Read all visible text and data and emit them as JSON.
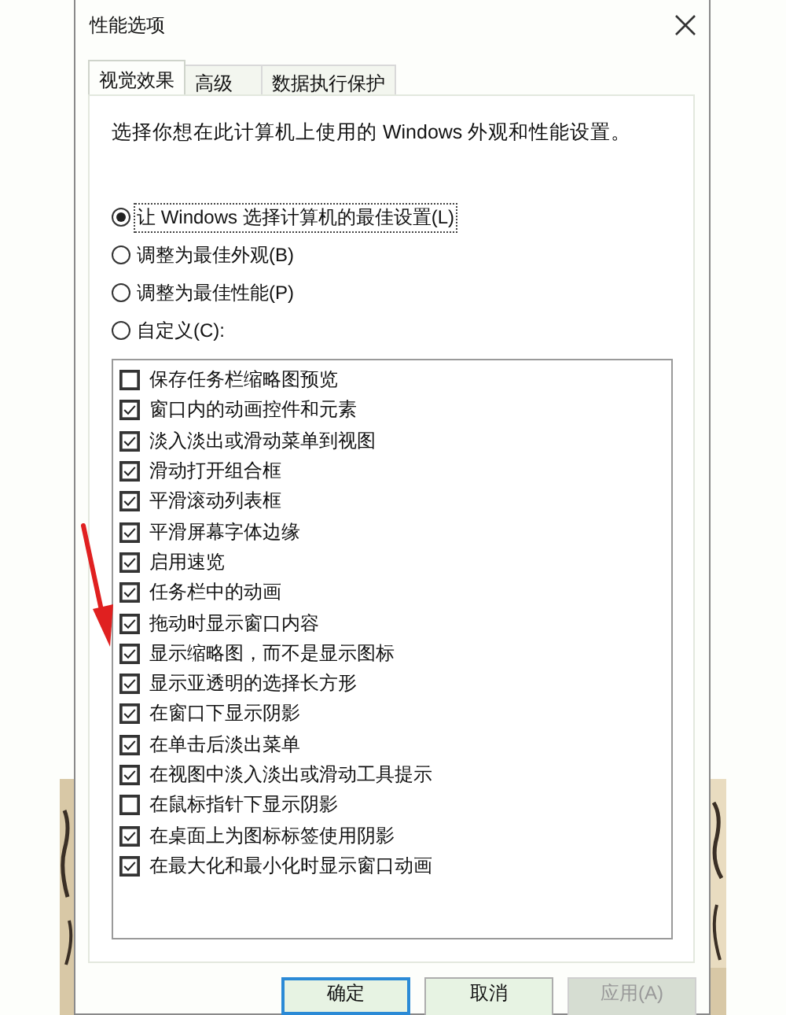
{
  "window": {
    "title": "性能选项"
  },
  "tabs": [
    {
      "label": "视觉效果",
      "selected": true
    },
    {
      "label": "高级",
      "selected": false
    },
    {
      "label": "数据执行保护",
      "selected": false
    }
  ],
  "description": "选择你想在此计算机上使用的 Windows 外观和性能设置。",
  "radios": [
    {
      "label": "让 Windows 选择计算机的最佳设置(L)",
      "selected": true
    },
    {
      "label": "调整为最佳外观(B)",
      "selected": false
    },
    {
      "label": "调整为最佳性能(P)",
      "selected": false
    },
    {
      "label": "自定义(C):",
      "selected": false
    }
  ],
  "options": [
    {
      "label": "保存任务栏缩略图预览",
      "checked": false
    },
    {
      "label": "窗口内的动画控件和元素",
      "checked": true
    },
    {
      "label": "淡入淡出或滑动菜单到视图",
      "checked": true
    },
    {
      "label": "滑动打开组合框",
      "checked": true
    },
    {
      "label": "平滑滚动列表框",
      "checked": true
    },
    {
      "label": "平滑屏幕字体边缘",
      "checked": true
    },
    {
      "label": "启用速览",
      "checked": true
    },
    {
      "label": "任务栏中的动画",
      "checked": true
    },
    {
      "label": "拖动时显示窗口内容",
      "checked": true
    },
    {
      "label": "显示缩略图，而不是显示图标",
      "checked": true
    },
    {
      "label": "显示亚透明的选择长方形",
      "checked": true
    },
    {
      "label": "在窗口下显示阴影",
      "checked": true
    },
    {
      "label": "在单击后淡出菜单",
      "checked": true
    },
    {
      "label": "在视图中淡入淡出或滑动工具提示",
      "checked": true
    },
    {
      "label": "在鼠标指针下显示阴影",
      "checked": false
    },
    {
      "label": "在桌面上为图标标签使用阴影",
      "checked": true
    },
    {
      "label": "在最大化和最小化时显示窗口动画",
      "checked": true
    }
  ],
  "buttons": [
    {
      "label": "确定",
      "kind": "default",
      "disabled": false
    },
    {
      "label": "取消",
      "kind": "normal",
      "disabled": false
    },
    {
      "label": "应用(A)",
      "kind": "normal",
      "disabled": true
    }
  ]
}
